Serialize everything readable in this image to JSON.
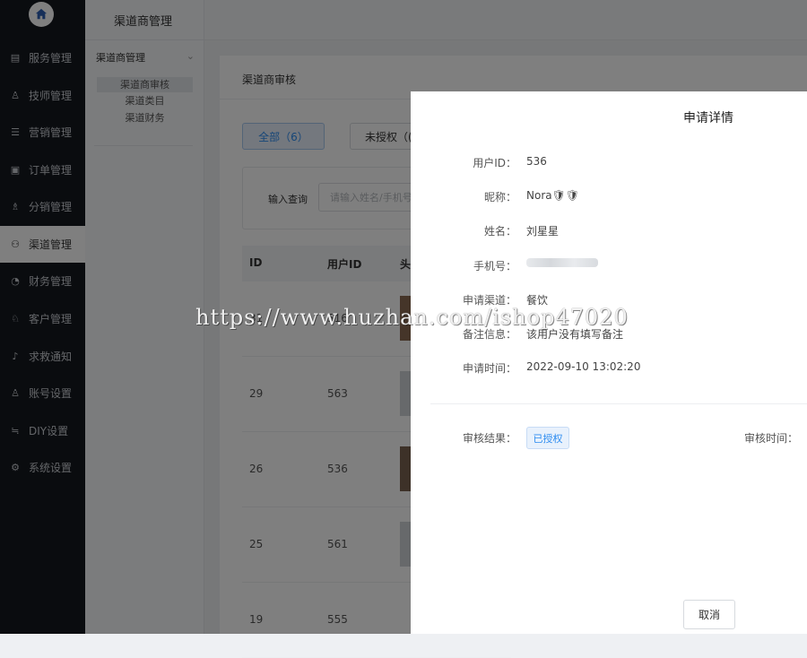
{
  "sidebar": {
    "items": [
      {
        "label": "服务管理",
        "icon": "service-icon"
      },
      {
        "label": "技师管理",
        "icon": "user-icon"
      },
      {
        "label": "营销管理",
        "icon": "marketing-icon"
      },
      {
        "label": "订单管理",
        "icon": "order-icon"
      },
      {
        "label": "分销管理",
        "icon": "distribution-icon"
      },
      {
        "label": "渠道管理",
        "icon": "channel-icon"
      },
      {
        "label": "财务管理",
        "icon": "finance-icon"
      },
      {
        "label": "客户管理",
        "icon": "customer-icon"
      },
      {
        "label": "求救通知",
        "icon": "bell-icon"
      },
      {
        "label": "账号设置",
        "icon": "account-icon"
      },
      {
        "label": "DIY设置",
        "icon": "diy-icon"
      },
      {
        "label": "系统设置",
        "icon": "gear-icon"
      }
    ],
    "active_index": 5
  },
  "subnav": {
    "header": "渠道商管理",
    "group": "渠道商管理",
    "items": [
      "渠道商审核",
      "渠道类目",
      "渠道财务"
    ]
  },
  "main": {
    "title": "渠道商审核",
    "filters": {
      "all": "全部（6）",
      "unauth": "未授权（("
    },
    "search": {
      "label": "输入查询",
      "placeholder": "请输入姓名/手机号"
    },
    "columns": [
      "ID",
      "用户ID",
      "头"
    ],
    "rows": [
      {
        "id": "31",
        "user_id": "516"
      },
      {
        "id": "29",
        "user_id": "563"
      },
      {
        "id": "26",
        "user_id": "536"
      },
      {
        "id": "25",
        "user_id": "561"
      },
      {
        "id": "19",
        "user_id": "555"
      }
    ]
  },
  "drawer": {
    "title": "申请详情",
    "fields": [
      {
        "label": "用户ID：",
        "value": "536"
      },
      {
        "label": "昵称：",
        "value": "Nora🛡🛡"
      },
      {
        "label": "姓名：",
        "value": "刘星星"
      },
      {
        "label": "手机号：",
        "value": ""
      },
      {
        "label": "申请渠道：",
        "value": "餐饮"
      },
      {
        "label": "备注信息：",
        "value": "该用户没有填写备注"
      },
      {
        "label": "申请时间：",
        "value": "2022-09-10 13:02:20"
      }
    ],
    "review_label": "审核结果：",
    "review_status": "已授权",
    "review_time_label": "审核时间：",
    "cancel_label": "取消"
  },
  "watermark": "https://www.huzhan.com/ishop47020",
  "colors": {
    "primary": "#2d8cf0",
    "sidebar_bg": "#15191f"
  }
}
